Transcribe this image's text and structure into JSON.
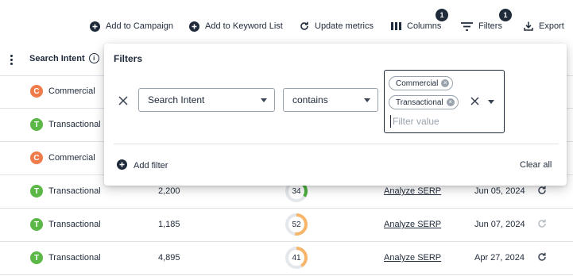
{
  "toolbar": {
    "add_campaign": "Add to Campaign",
    "add_keyword_list": "Add to Keyword List",
    "update_metrics": "Update metrics",
    "columns": "Columns",
    "columns_badge": "1",
    "filters": "Filters",
    "filters_badge": "1",
    "export": "Export"
  },
  "table": {
    "header_intent": "Search Intent",
    "info_glyph": "i",
    "rows": [
      {
        "intent": "Commercial",
        "intent_letter": "C",
        "intent_color": "#f07b4a"
      },
      {
        "intent": "Transactional",
        "intent_letter": "T",
        "intent_color": "#5bb846"
      },
      {
        "intent": "Commercial",
        "intent_letter": "C",
        "intent_color": "#f07b4a"
      },
      {
        "intent": "Transactional",
        "intent_letter": "T",
        "intent_color": "#5bb846",
        "volume": "2,200",
        "kd": "34",
        "kd_fraction": 0.34,
        "kd_color": "#4cae3f",
        "serp": "Analyze SERP",
        "date": "Jun 05, 2024"
      },
      {
        "intent": "Transactional",
        "intent_letter": "T",
        "intent_color": "#5bb846",
        "volume": "1,185",
        "kd": "52",
        "kd_fraction": 0.52,
        "kd_color": "#f6b56a",
        "serp": "Analyze SERP",
        "date": "Jun 07, 2024"
      },
      {
        "intent": "Transactional",
        "intent_letter": "T",
        "intent_color": "#5bb846",
        "volume": "4,895",
        "kd": "41",
        "kd_fraction": 0.41,
        "kd_color": "#f6b56a",
        "serp": "Analyze SERP",
        "date": "Apr 27, 2024"
      }
    ]
  },
  "filters_panel": {
    "title": "Filters",
    "field": "Search Intent",
    "operator": "contains",
    "chips": [
      "Commercial",
      "Transactional"
    ],
    "chip_remove_glyph": "×",
    "value_placeholder": "Filter value",
    "add_filter": "Add filter",
    "clear_all": "Clear all"
  },
  "colors": {
    "primary": "#1f2a3a",
    "border": "#dfe3e8",
    "commercial": "#f07b4a",
    "transactional": "#5bb846"
  },
  "icons": [
    "plus-circle-icon",
    "refresh-icon",
    "columns-icon",
    "filter-icon",
    "export-icon",
    "info-icon",
    "close-icon",
    "caret-down-icon",
    "kebab-icon"
  ]
}
